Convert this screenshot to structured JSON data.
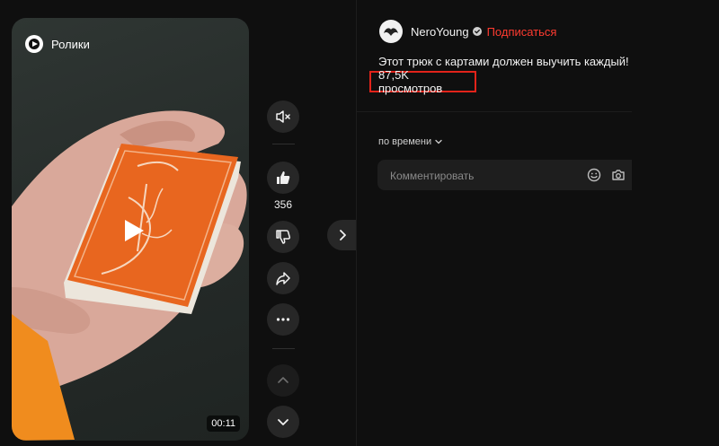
{
  "video": {
    "brand_label": "Ролики",
    "duration": "00:11"
  },
  "actions": {
    "like_count": "356"
  },
  "channel": {
    "name": "NeroYoung",
    "subscribe_label": "Подписаться"
  },
  "post": {
    "title": "Этот трюк с картами должен выучить каждый!",
    "views": "87,5K просмотров"
  },
  "comments": {
    "sort_label": "по времени",
    "placeholder": "Комментировать"
  },
  "colors": {
    "background": "#0f0f0f",
    "button_bg": "#272727",
    "accent_red": "#ff3b30",
    "card_orange": "#e8661f",
    "highlight_border": "#e2231a"
  },
  "icons": [
    "brand-logo-icon",
    "play-icon",
    "mute-icon",
    "thumbs-up-icon",
    "thumbs-down-icon",
    "share-icon",
    "more-icon",
    "chevron-up-icon",
    "chevron-down-icon",
    "chevron-right-icon",
    "verified-icon",
    "emoji-icon",
    "camera-icon"
  ]
}
